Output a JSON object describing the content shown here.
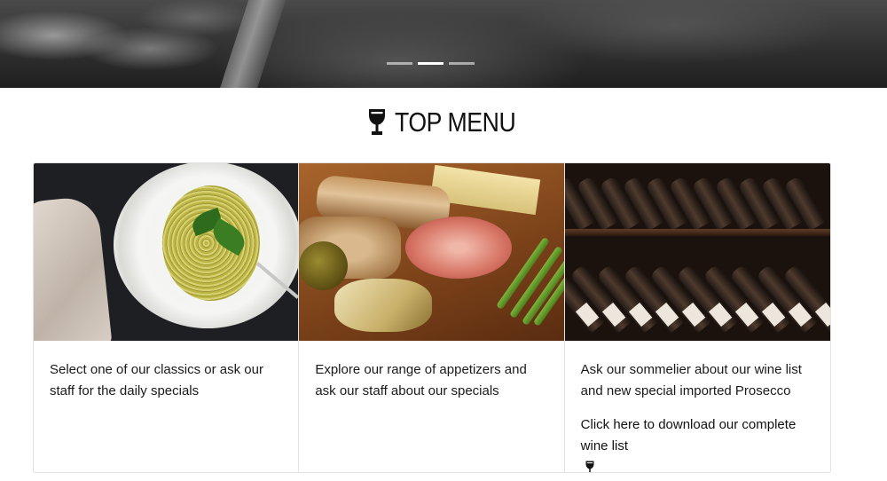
{
  "hero": {
    "carousel_indicators": [
      {
        "label": "Slide 1",
        "active": false
      },
      {
        "label": "Slide 2",
        "active": true
      },
      {
        "label": "Slide 3",
        "active": false
      }
    ]
  },
  "section": {
    "title": "TOP MENU",
    "icon": "wine-glass-icon"
  },
  "cards": [
    {
      "image": "pasta-plate-image",
      "text": "Select one of our classics or ask our staff for the daily specials"
    },
    {
      "image": "appetizer-board-image",
      "text": "Explore our range of appetizers and ask our staff about our specials"
    },
    {
      "image": "wine-rack-image",
      "text": "Ask our sommelier about our wine list and new special imported Prosecco",
      "link": "Click here to download our complete wine list",
      "link_icon": "wine-glass-icon"
    }
  ],
  "colors": {
    "text": "#111111",
    "border": "#e2e2e2",
    "background": "#ffffff"
  }
}
